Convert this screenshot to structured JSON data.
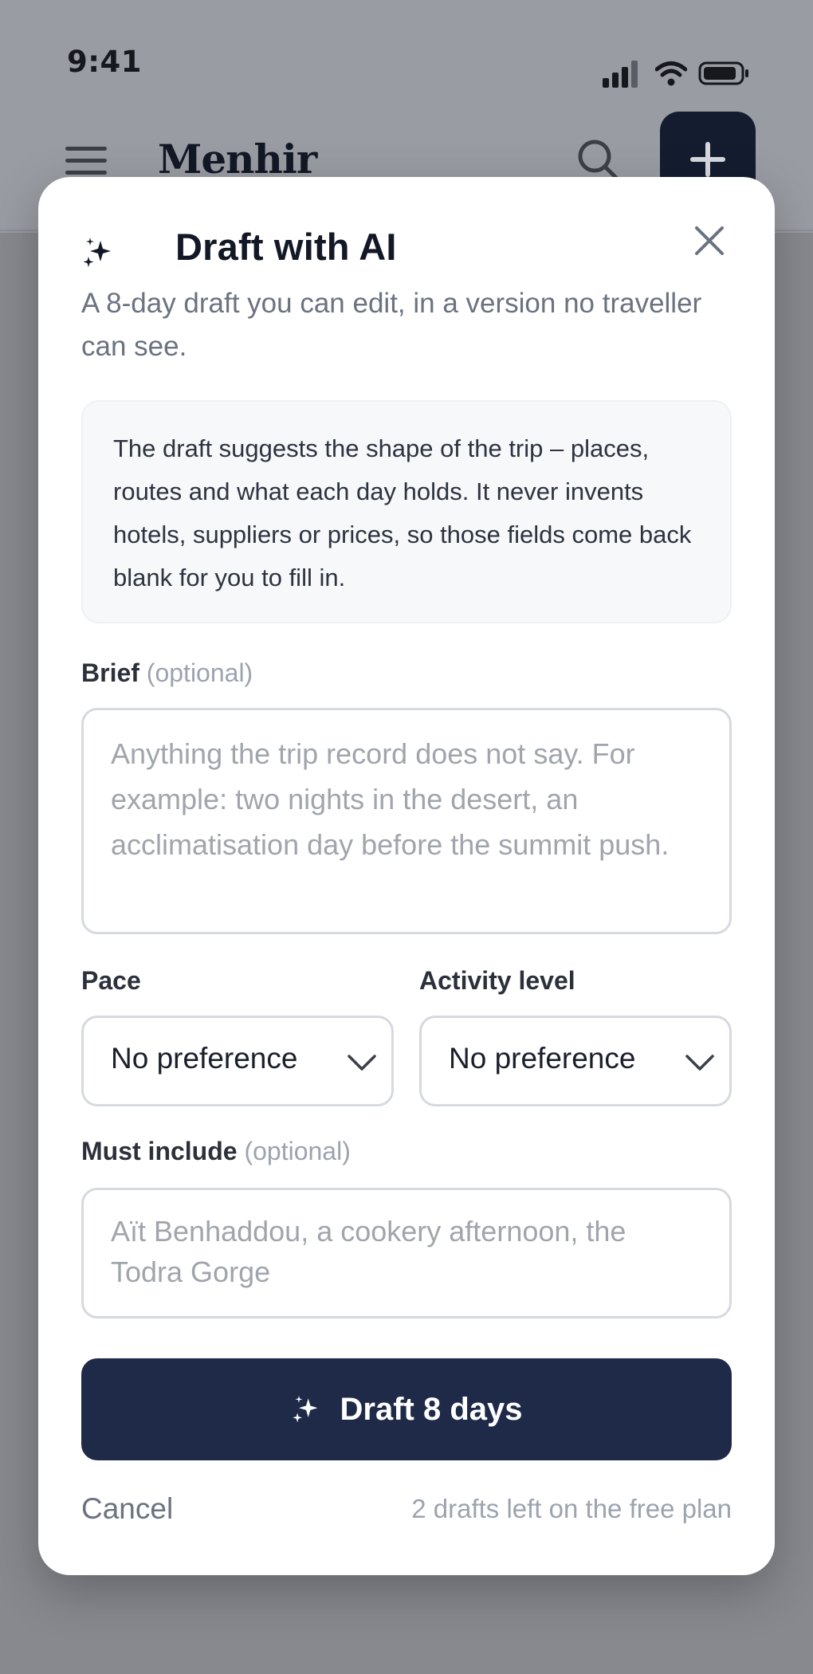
{
  "status_bar": {
    "time": "9:41",
    "icons": [
      "cellular-signal-icon",
      "wifi-icon",
      "battery-icon"
    ]
  },
  "app_header": {
    "brand": "Menhir",
    "icons": [
      "menu-icon",
      "search-icon",
      "plus-icon"
    ]
  },
  "modal": {
    "title": "Draft with AI",
    "title_icon": "sparkle-icon",
    "close_icon": "close-icon",
    "subtitle": "A 8-day draft you can edit, in a version no traveller can see.",
    "info": "The draft suggests the shape of the trip – places, routes and what each day holds. It never invents hotels, suppliers or prices, so those fields come back blank for you to fill in.",
    "brief": {
      "label": "Brief",
      "optional": "(optional)",
      "value": "",
      "placeholder": "Anything the trip record does not say. For example: two nights in the desert, an acclimatisation day before the summit push."
    },
    "pace": {
      "label": "Pace",
      "selected": "No preference"
    },
    "activity_level": {
      "label": "Activity level",
      "selected": "No preference"
    },
    "must_include": {
      "label": "Must include",
      "optional": "(optional)",
      "value": "",
      "placeholder": "Aït Benhaddou, a cookery afternoon, the Todra Gorge"
    },
    "primary_button": "Draft 8 days",
    "cancel": "Cancel",
    "quota": "2 drafts left on the free plan"
  },
  "colors": {
    "primary": "#1f2a48",
    "overlay": "#87898f",
    "muted_text": "#6b7280",
    "placeholder_text": "#a0a5ad"
  }
}
